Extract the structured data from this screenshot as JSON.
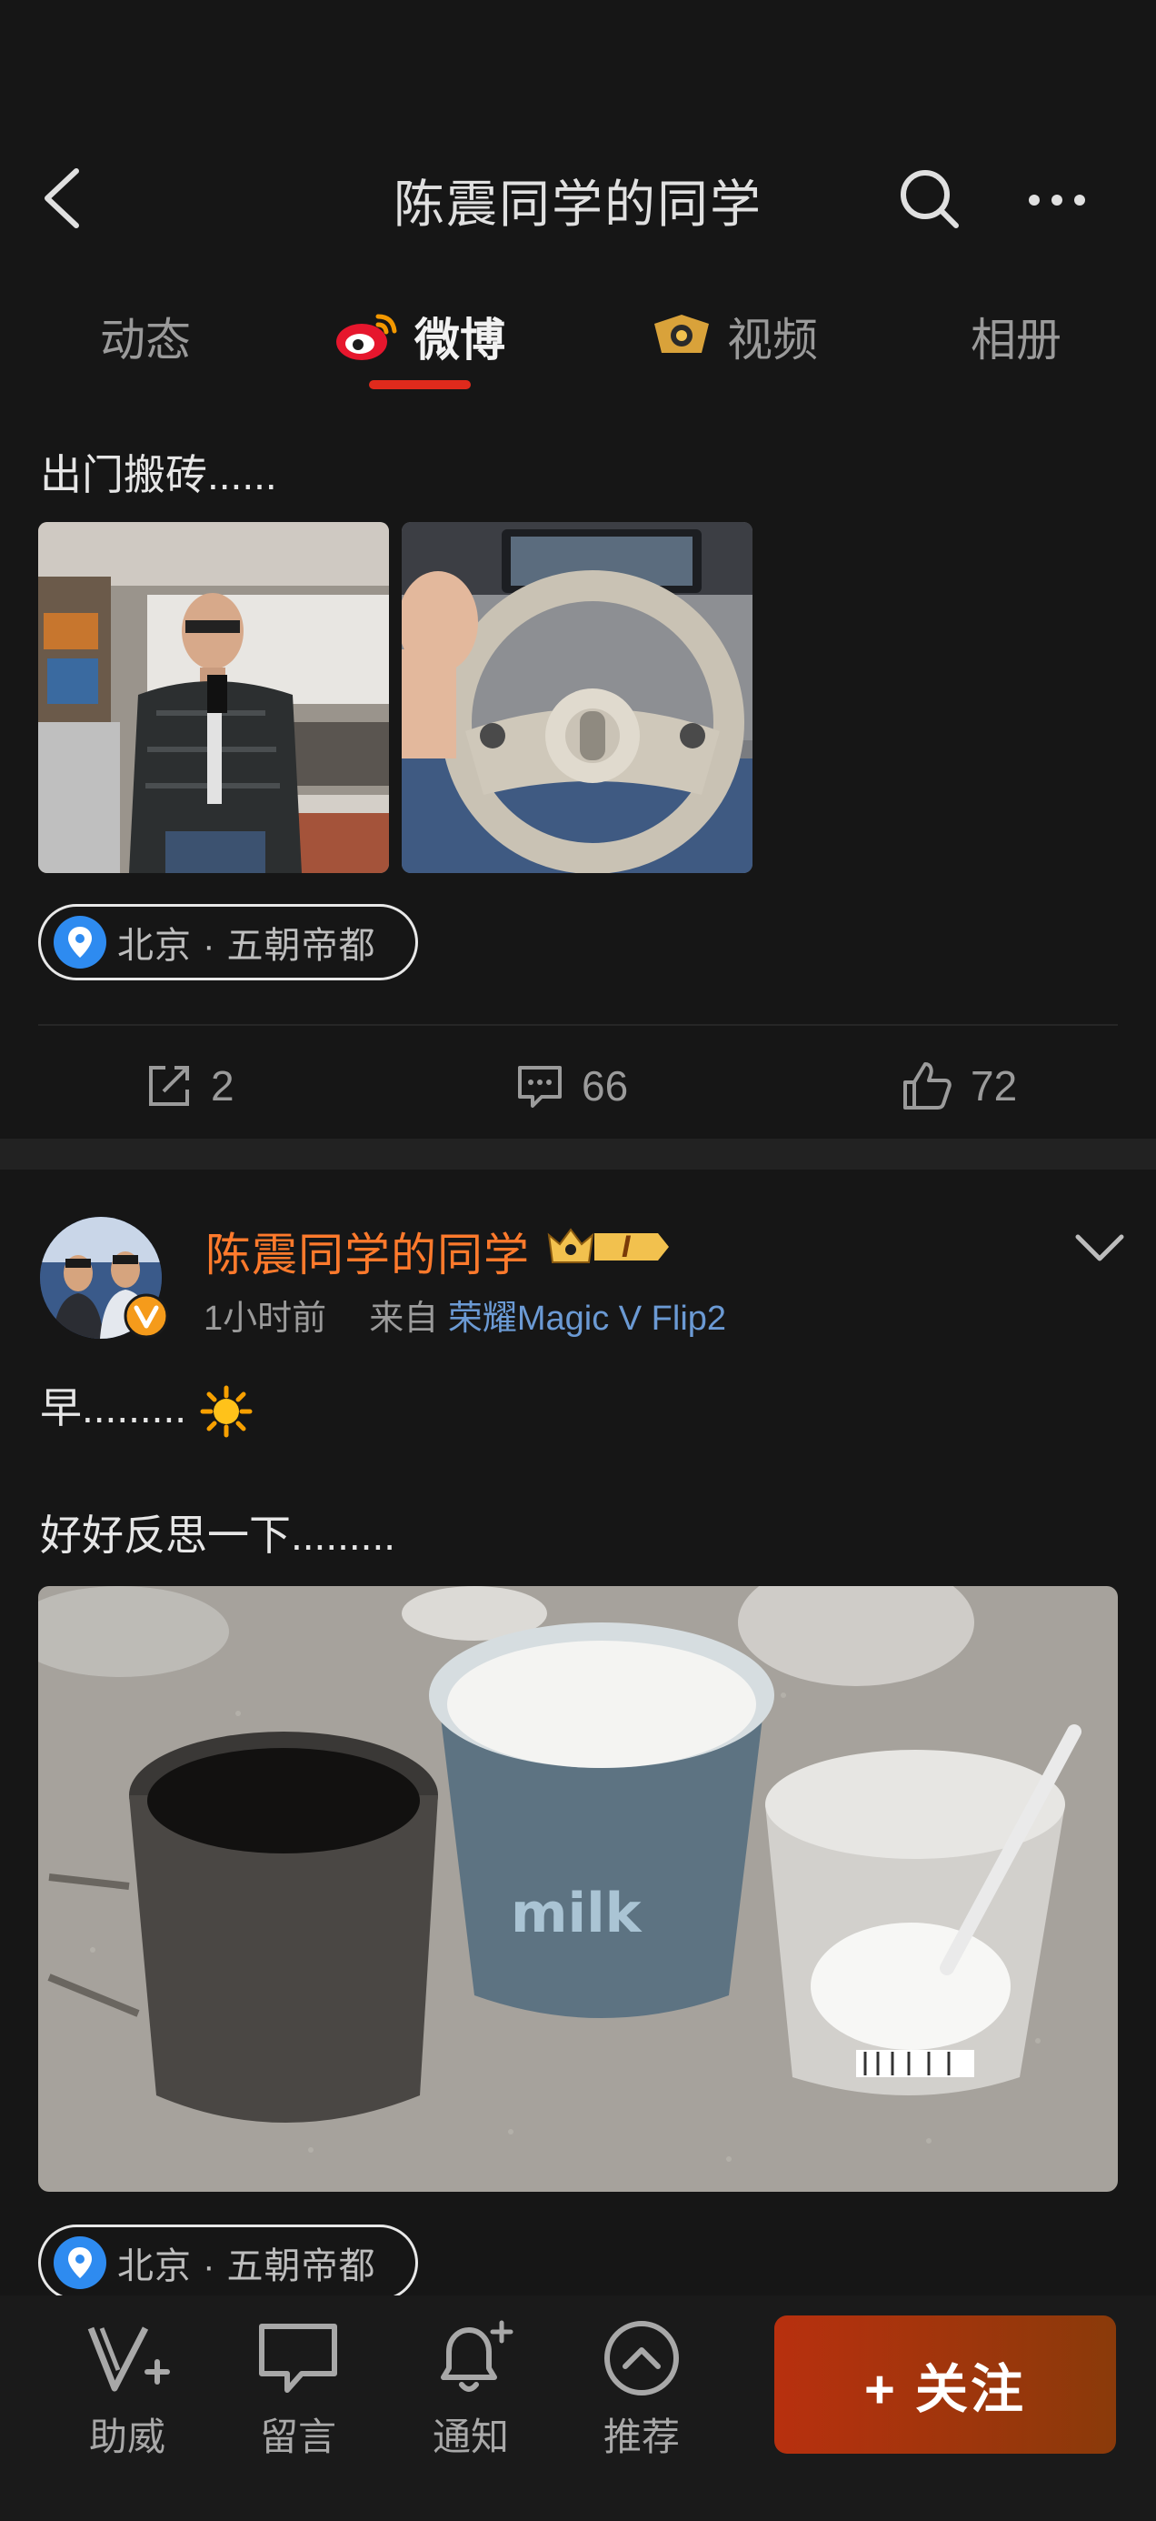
{
  "header": {
    "title": "陈震同学的同学"
  },
  "tabs": [
    {
      "label": "动态"
    },
    {
      "label": "微博"
    },
    {
      "label": "视频"
    },
    {
      "label": "相册"
    }
  ],
  "post1": {
    "text": "出门搬砖......",
    "location": "北京 · 五朝帝都",
    "actions": {
      "repost": "2",
      "comments": "66",
      "likes": "72"
    }
  },
  "post2": {
    "author": "陈震同学的同学",
    "vip_level": "I",
    "time": "1小时前",
    "from_label": "来自",
    "source": "荣耀Magic V Flip2",
    "text_line1": "早.........",
    "text_line2": "好好反思一下.........",
    "location": "北京 · 五朝帝都"
  },
  "bottom_nav": {
    "items": [
      {
        "label": "助威",
        "icon": "cheer-icon"
      },
      {
        "label": "留言",
        "icon": "message-icon"
      },
      {
        "label": "通知",
        "icon": "bell-icon"
      },
      {
        "label": "推荐",
        "icon": "recommend-icon"
      }
    ],
    "follow_label": "+ 关注"
  },
  "colors": {
    "background": "#161616",
    "accent_red": "#e02a1c",
    "author_orange": "#ff7a2c",
    "source_blue": "#6b9ad4",
    "follow_button": "#b8300e"
  }
}
